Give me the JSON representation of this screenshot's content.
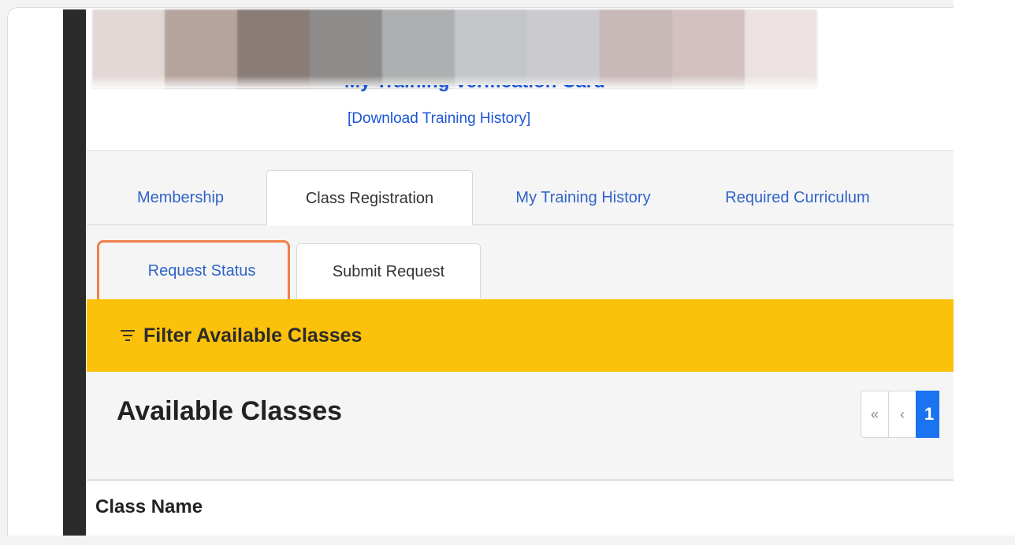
{
  "header": {
    "card_title": "My Training Verification Card",
    "download_link": "[Download Training History]"
  },
  "banner_colors": [
    "#e2d8d6",
    "#b6a49e",
    "#8a7d78",
    "#8e8c8a",
    "#aeafb0",
    "#c4c6c9",
    "#cbcbcf",
    "#c8b8b8",
    "#d2c1c0",
    "#ece2e1"
  ],
  "main_tabs": [
    {
      "label": "Membership",
      "active": false
    },
    {
      "label": "Class Registration",
      "active": true
    },
    {
      "label": "My Training History",
      "active": false
    },
    {
      "label": "Required Curriculum",
      "active": false
    }
  ],
  "sub_tabs": [
    {
      "label": "Request Status",
      "active": false,
      "highlighted": true
    },
    {
      "label": "Submit Request",
      "active": true
    }
  ],
  "filter": {
    "icon": "filter-icon",
    "label": "Filter Available Classes"
  },
  "classes": {
    "title": "Available Classes",
    "pager": {
      "first": "«",
      "prev": "‹",
      "current_page": "1"
    },
    "column_header": "Class Name"
  },
  "colors": {
    "link": "#1a55d6",
    "filter_bar": "#fcc10a",
    "highlight": "#f07f4a",
    "pager_active": "#1a73f0"
  }
}
